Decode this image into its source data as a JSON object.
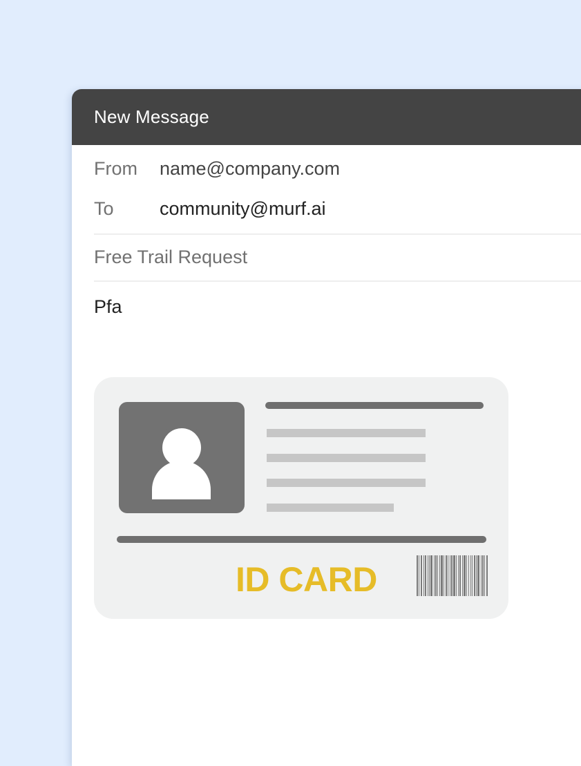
{
  "window": {
    "title": "New Message"
  },
  "header": {
    "from_label": "From",
    "from_value": "name@company.com",
    "to_label": "To",
    "to_value": "community@murf.ai"
  },
  "subject": "Free Trail Request",
  "body": "Pfa",
  "attachment": {
    "type": "id-card-image",
    "card_title": "ID CARD",
    "title_color": "#e6bc28",
    "icons": [
      "user-avatar-icon",
      "barcode-icon"
    ]
  },
  "colors": {
    "background": "#e1edfd",
    "titlebar": "#444444",
    "card": "#f0f1f1"
  }
}
